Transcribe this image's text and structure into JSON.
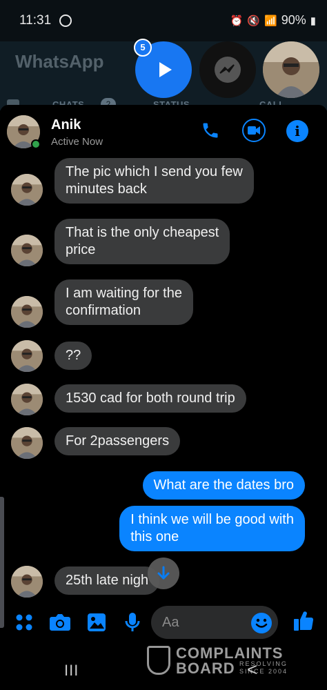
{
  "status_bar": {
    "time": "11:31",
    "battery": "90%",
    "icons": [
      "messenger-icon",
      "alarm-icon",
      "mute-icon",
      "wifi-icon",
      "signal-icon",
      "battery-icon"
    ]
  },
  "backdrop": {
    "app_title": "WhatsApp",
    "tabs": [
      "CHATS",
      "STATUS",
      "CALL"
    ],
    "chats_count": "2"
  },
  "chat_heads": {
    "badge_count": "5"
  },
  "header": {
    "name": "Anik",
    "status": "Active Now"
  },
  "messages": [
    {
      "direction": "in",
      "text_lines": [
        "The pic which I send you few",
        "minutes back"
      ]
    },
    {
      "direction": "in",
      "text_lines": [
        "That  is the only cheapest",
        "price"
      ]
    },
    {
      "direction": "in",
      "text_lines": [
        "I am waiting for the",
        "confirmation"
      ]
    },
    {
      "direction": "in",
      "text_lines": [
        "??"
      ]
    },
    {
      "direction": "in",
      "text_lines": [
        "1530 cad for both round trip"
      ]
    },
    {
      "direction": "in",
      "text_lines": [
        "For 2passengers"
      ]
    },
    {
      "direction": "out",
      "text_lines": [
        "What are the dates bro"
      ]
    },
    {
      "direction": "out",
      "text_lines": [
        "I think we will be good with",
        "this one"
      ]
    },
    {
      "direction": "in",
      "text_lines": [
        "25th late nigh"
      ]
    }
  ],
  "composer": {
    "placeholder": "Aa"
  },
  "nav": {
    "recents": "III",
    "back": "<"
  },
  "watermark": {
    "line1": "COMPLAINTS",
    "line2": "BOARD",
    "tag1": "RESOLVING",
    "tag2": "SINCE 2004"
  },
  "colors": {
    "accent": "#0a84ff",
    "incoming_bubble": "#3a3b3c",
    "online": "#31a24c",
    "whatsapp_bg": "#101d25"
  }
}
